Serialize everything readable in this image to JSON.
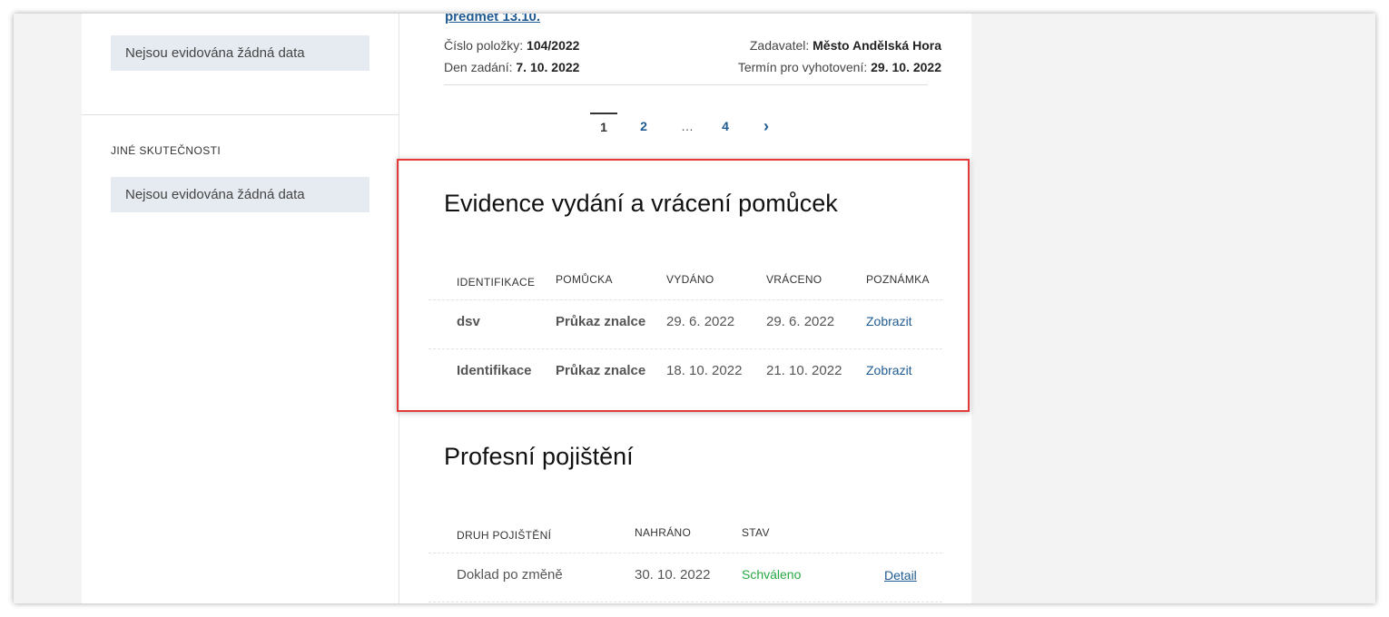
{
  "sidebar": {
    "no_data_1": "Nejsou evidována žádná data",
    "other_facts_heading": "JINÉ SKUTEČNOSTI",
    "no_data_2": "Nejsou evidována žádná data"
  },
  "previous_item": {
    "link_text": "predmet 13.10.",
    "item_number_label": "Číslo položky:",
    "item_number": "104/2022",
    "submitter_label": "Zadavatel:",
    "submitter": "Město Andělská Hora",
    "assigned_label": "Den zadání:",
    "assigned_date": "7. 10. 2022",
    "deadline_label": "Termín pro vyhotovení:",
    "deadline_date": "29. 10. 2022"
  },
  "pagination": {
    "pages": [
      "1",
      "2",
      "…",
      "4"
    ],
    "next": "›"
  },
  "aids_section": {
    "title": "Evidence vydání a vrácení pomůcek",
    "headers": [
      "IDENTIFIKACE",
      "POMŮCKA",
      "VYDÁNO",
      "VRÁCENO",
      "POZNÁMKA"
    ],
    "rows": [
      {
        "id": "dsv",
        "aid": "Průkaz znalce",
        "issued": "29. 6. 2022",
        "returned": "29. 6. 2022",
        "note": "Zobrazit"
      },
      {
        "id": "Identifikace",
        "aid": "Průkaz znalce",
        "issued": "18. 10. 2022",
        "returned": "21. 10. 2022",
        "note": "Zobrazit"
      }
    ]
  },
  "insurance_section": {
    "title": "Profesní pojištění",
    "headers": [
      "DRUH POJIŠTĚNÍ",
      "NAHRÁNO",
      "STAV",
      ""
    ],
    "rows": [
      {
        "type": "Doklad po změně",
        "uploaded": "30. 10. 2022",
        "status": "Schváleno",
        "action": "Detail"
      }
    ]
  },
  "colors": {
    "accent_link": "#1f5b92",
    "status_approved": "#27a844",
    "highlight_border": "#e53a3a",
    "nodata_bg": "#e6ebf1"
  }
}
